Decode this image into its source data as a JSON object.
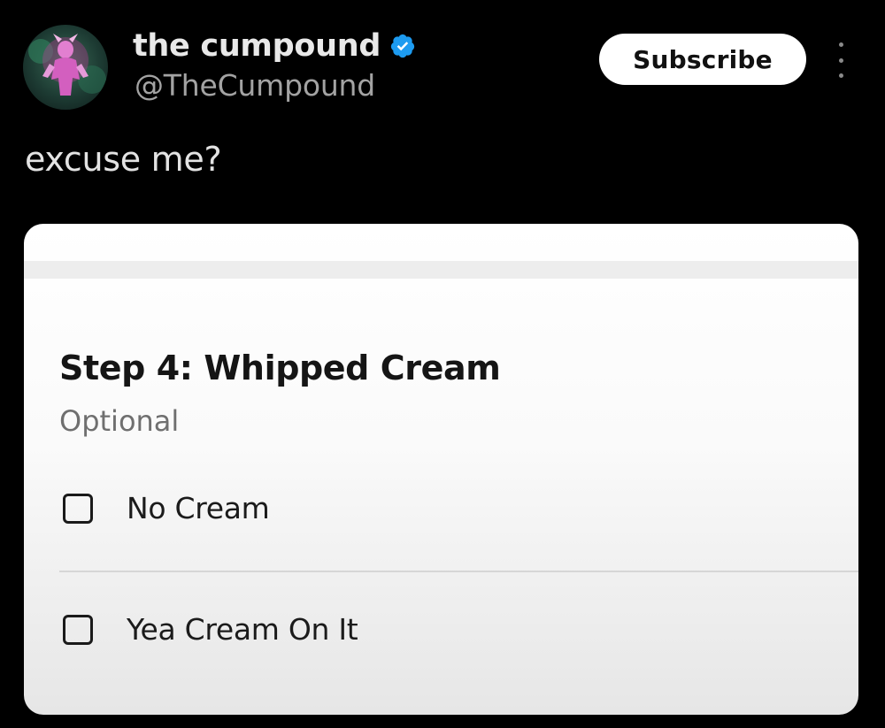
{
  "post": {
    "author": {
      "display_name": "the cumpound",
      "handle": "@TheCumpound",
      "verified": true,
      "verified_color": "#1d9bf0"
    },
    "subscribe_label": "Subscribe",
    "more_icon": "vertical-ellipsis-icon",
    "text": "excuse me?"
  },
  "embedded_screenshot": {
    "title": "Step 4: Whipped Cream",
    "subtitle": "Optional",
    "options": [
      {
        "label": "No Cream",
        "checked": false
      },
      {
        "label": "Yea Cream On It",
        "checked": false
      }
    ]
  },
  "colors": {
    "background": "#000000",
    "handle_text": "#a3a3a3",
    "card_background": "#ffffff"
  }
}
